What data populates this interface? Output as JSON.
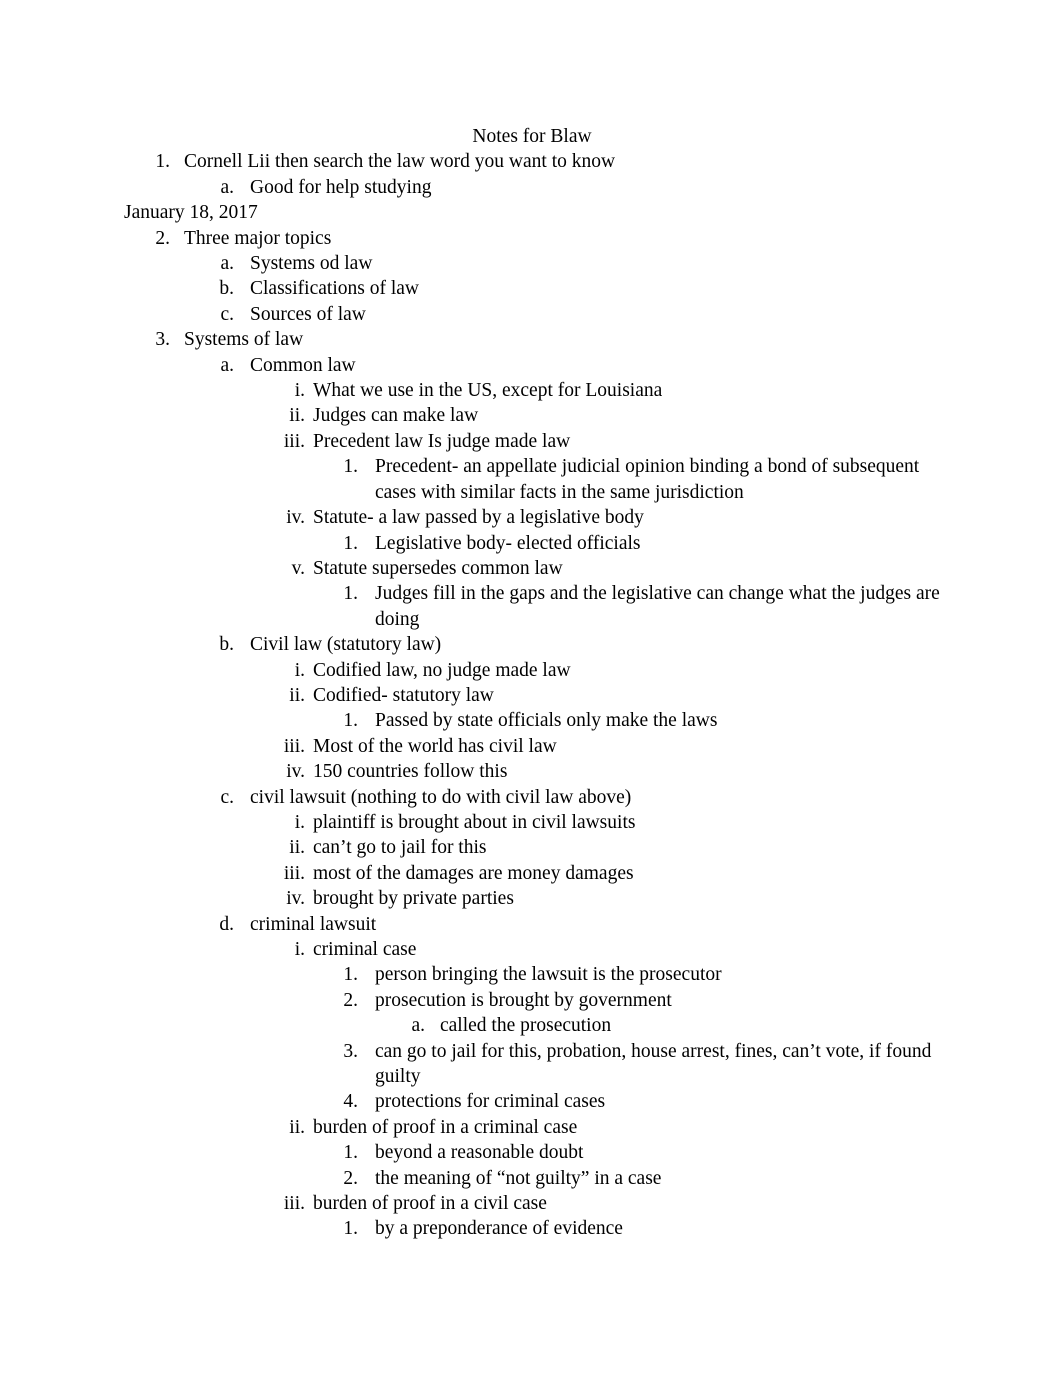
{
  "document": {
    "title": "Notes for Blaw",
    "date_line": "January 18, 2017",
    "lines": [
      {
        "level": 1,
        "marker": "1.",
        "text": "Cornell Lii then search the law word you want to know"
      },
      {
        "level": 2,
        "marker": "a.",
        "text": "Good for help studying"
      },
      {
        "level": 1,
        "marker": "2.",
        "text": "Three major topics"
      },
      {
        "level": 2,
        "marker": "a.",
        "text": "Systems od law"
      },
      {
        "level": 2,
        "marker": "b.",
        "text": "Classifications of law"
      },
      {
        "level": 2,
        "marker": "c.",
        "text": "Sources of law"
      },
      {
        "level": 1,
        "marker": "3.",
        "text": "Systems of law"
      },
      {
        "level": 2,
        "marker": "a.",
        "text": "Common law"
      },
      {
        "level": 3,
        "marker": "i.",
        "text": "What we use in the US, except for Louisiana"
      },
      {
        "level": 3,
        "marker": "ii.",
        "text": "Judges can make law"
      },
      {
        "level": 3,
        "marker": "iii.",
        "text": "Precedent law Is judge made law"
      },
      {
        "level": 4,
        "marker": "1.",
        "text": "Precedent- an appellate judicial opinion binding a bond of subsequent cases with similar facts in the same jurisdiction"
      },
      {
        "level": 3,
        "marker": "iv.",
        "text": "Statute- a law passed by a legislative body"
      },
      {
        "level": 4,
        "marker": "1.",
        "text": "Legislative body- elected officials"
      },
      {
        "level": 3,
        "marker": "v.",
        "text": "Statute supersedes common law"
      },
      {
        "level": 4,
        "marker": "1.",
        "text": "Judges fill in the gaps and the legislative can change what the judges are doing"
      },
      {
        "level": 2,
        "marker": "b.",
        "text": "Civil law (statutory law)"
      },
      {
        "level": 3,
        "marker": "i.",
        "text": "Codified law, no judge made law"
      },
      {
        "level": 3,
        "marker": "ii.",
        "text": "Codified- statutory law"
      },
      {
        "level": 4,
        "marker": "1.",
        "text": "Passed by state officials only make the laws"
      },
      {
        "level": 3,
        "marker": "iii.",
        "text": "Most of the world has civil law"
      },
      {
        "level": 3,
        "marker": "iv.",
        "text": "150 countries follow this"
      },
      {
        "level": 2,
        "marker": "c.",
        "text": "civil lawsuit (nothing to do with civil law above)"
      },
      {
        "level": 3,
        "marker": "i.",
        "text": "plaintiff is brought about in civil lawsuits"
      },
      {
        "level": 3,
        "marker": "ii.",
        "text": "can’t go to jail for this"
      },
      {
        "level": 3,
        "marker": "iii.",
        "text": "most of the damages are money damages"
      },
      {
        "level": 3,
        "marker": "iv.",
        "text": "brought by private parties"
      },
      {
        "level": 2,
        "marker": "d.",
        "text": "criminal lawsuit"
      },
      {
        "level": 3,
        "marker": "i.",
        "text": "criminal case"
      },
      {
        "level": 4,
        "marker": "1.",
        "text": "person bringing the lawsuit is the prosecutor"
      },
      {
        "level": 4,
        "marker": "2.",
        "text": "prosecution is brought by government"
      },
      {
        "level": 5,
        "marker": "a.",
        "text": "called the prosecution"
      },
      {
        "level": 4,
        "marker": "3.",
        "text": "can go to jail for this, probation, house arrest, fines, can’t vote, if found guilty"
      },
      {
        "level": 4,
        "marker": "4.",
        "text": "protections for criminal cases"
      },
      {
        "level": 3,
        "marker": "ii.",
        "text": "burden of proof in a criminal case"
      },
      {
        "level": 4,
        "marker": "1.",
        "text": "beyond a reasonable doubt"
      },
      {
        "level": 4,
        "marker": "2.",
        "text": "the meaning of “not guilty” in a case"
      },
      {
        "level": 3,
        "marker": "iii.",
        "text": "burden of proof in a civil case"
      },
      {
        "level": 4,
        "marker": "1.",
        "text": "by a preponderance of evidence"
      }
    ],
    "date_line_after_index": 1
  },
  "colors": {
    "page_background": "#ffffff",
    "text": "#000000"
  }
}
